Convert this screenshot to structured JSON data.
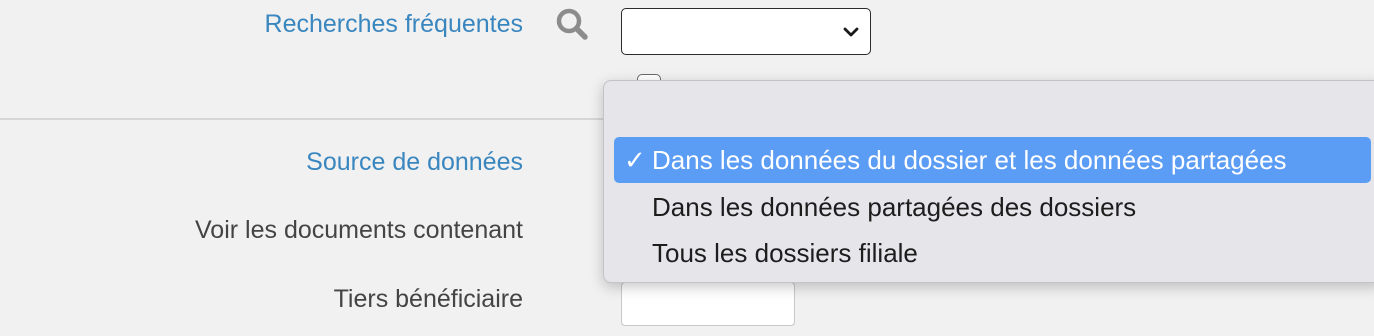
{
  "form": {
    "frequent_searches_label": "Recherches fréquentes",
    "frequent_searches_value": "",
    "data_source_label": "Source de données",
    "view_documents_label": "Voir les documents contenant",
    "beneficiary_label": "Tiers bénéficiaire",
    "beneficiary_value": ""
  },
  "dropdown": {
    "options": [
      {
        "check": "✓",
        "label": "Dans les données du dossier et les données partagées",
        "selected": true
      },
      {
        "check": "",
        "label": "Dans les données partagées des dossiers",
        "selected": false
      },
      {
        "check": "",
        "label": "Tous les dossiers filiale",
        "selected": false
      }
    ]
  },
  "colors": {
    "link_label": "#3a86bf",
    "selected_option_bg": "#5b9cf5",
    "page_bg": "#f1f1f1",
    "menu_bg": "#e5e5ea"
  },
  "icons": {
    "search": "search-icon",
    "chevron": "chevron-down-icon",
    "check": "check-icon"
  }
}
